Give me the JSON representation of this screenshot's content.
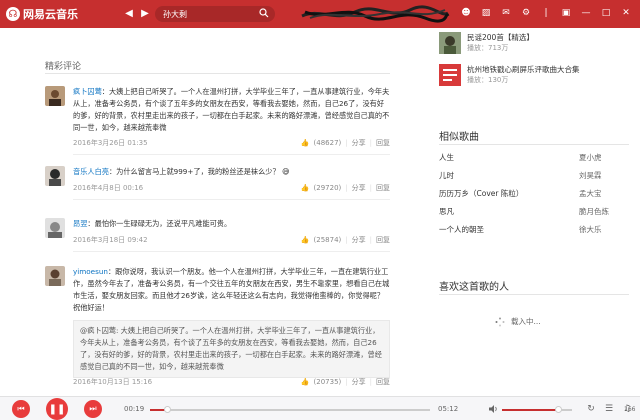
{
  "app": {
    "logo_text": "网易云音乐"
  },
  "search": {
    "value": "孙大剩"
  },
  "colors": {
    "brand": "#c62f2f",
    "link": "#0c73c2",
    "player_button": "#e83c3c"
  },
  "comments": {
    "section_title": "精彩评论",
    "items": [
      {
        "user": "疯卜囚莺",
        "text": "大姨上把自己听哭了。一个人在温州打拼，大学毕业三年了，一直从事建筑行业，今年夫从上，准备考公务员，有个谈了五年多的女朋友在西安，等看我去娶她，然而，自己26了，没有好的爹，好的背景，农村里走出来的孩子，一切都在白手起家。未来的路好漂滩，曾经感觉自己真的不同一世，如今，越来越荒奉微",
        "time": "2016年3月26日 01:35",
        "likes": "(48627)",
        "share": "分享",
        "reply": "回复"
      },
      {
        "user": "音乐人白亮",
        "text": "为什么留言马上就999+了，我的粉丝还是袜么少？",
        "time": "2016年4月8日 00:16",
        "likes": "(29720)",
        "share": "分享",
        "reply": "回复"
      },
      {
        "user": "昂翌",
        "text": "最怕你一生碌碌无为，还说平凡难能可贵。",
        "time": "2016年3月18日 09:42",
        "likes": "(25874)",
        "share": "分享",
        "reply": "回复"
      },
      {
        "user": "yimoesun",
        "text": "跟你说呀，我认识一个朋友。他一个人在温州打拼，大学毕业三年，一直在建筑行业工作，虽然今年去了，准备考公务员，有一个交往五年的女朋友在西安，男生不靠家里，想看自己在城市生活，娶女朋友回家。而且他才26岁诶，这么年轻还这么有志向，我觉得他蛮棒的，你觉得呢？祝他好运！",
        "quote": "@疯卜囚莺: 大姨上把自己听哭了。一个人在温州打拼，大学毕业三年了，一直从事建筑行业，今年夫从上，准备考公务员，有个谈了五年多的女朋友在西安，等看我去娶她，然而，自己26了，没有好的爹，好的背景，农村里走出来的孩子，一切都在白手起家。未来的路好漂滩，曾经感觉自己真的不同一世，如今，越来越荒奉微",
        "time": "2016年10月13日 15:16",
        "likes": "(20735)",
        "share": "分享",
        "reply": "回复"
      }
    ]
  },
  "playlists": [
    {
      "title": "民谣200首【精选】",
      "count": "播放：713万"
    },
    {
      "title": "杭州地铁戳心刷屏乐评歌曲大合集",
      "count": "播放：130万"
    }
  ],
  "similar": {
    "heading": "相似歌曲",
    "songs": [
      {
        "name": "人生",
        "artist": "夏小虎"
      },
      {
        "name": "儿时",
        "artist": "刘昊霖"
      },
      {
        "name": "历历万乡（Cover 陈粒）",
        "artist": "孟大宝"
      },
      {
        "name": "思凡",
        "artist": "脆月色炼"
      },
      {
        "name": "一个人的朝圣",
        "artist": "徐大乐"
      }
    ]
  },
  "likes_section": {
    "heading": "喜欢这首歌的人",
    "loading": "载入中..."
  },
  "player": {
    "current_time": "00:19",
    "total_time": "05:12",
    "progress": 0.061,
    "volume": 0.8,
    "count": "166"
  }
}
